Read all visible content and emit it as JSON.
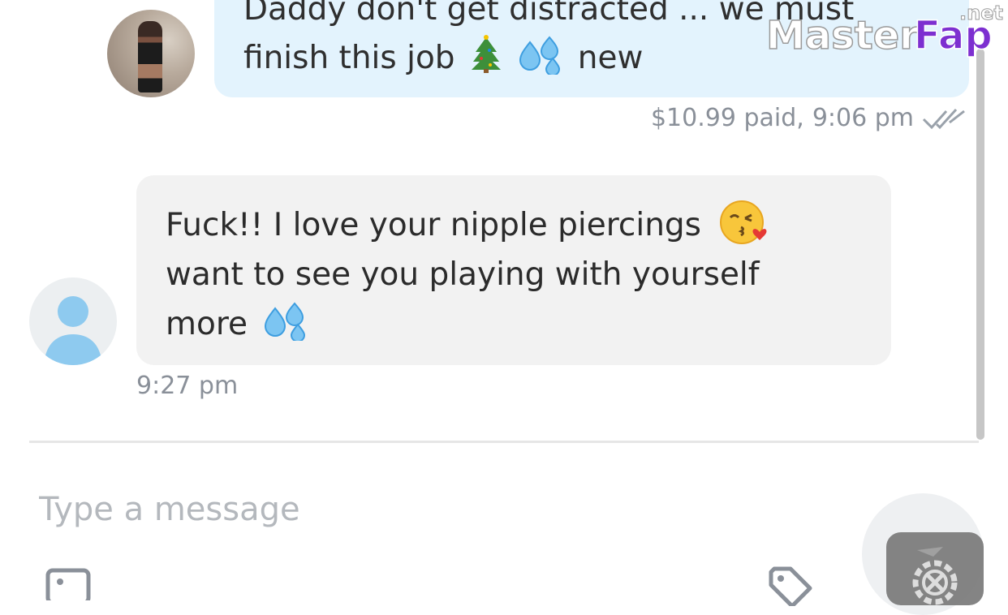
{
  "watermark": {
    "brand_part1": "Master",
    "brand_part2": "Fap",
    "suffix": ".net"
  },
  "conversation": {
    "sent_message": {
      "line1": "Daddy don't get distracted ... we must",
      "line2_start": "finish this job",
      "line2_end": "new",
      "emojis": [
        "christmas-tree",
        "sweat-droplets"
      ],
      "price": "$10.99 paid,",
      "time": "9:06 pm",
      "status_icon": "double-check-icon"
    },
    "received_message": {
      "line1": "Fuck!! I love your nipple piercings",
      "line2": "want to see you playing with yourself",
      "line3": "more",
      "emojis": [
        "face-blowing-a-kiss",
        "sweat-droplets"
      ],
      "time": "9:27 pm"
    }
  },
  "composer": {
    "placeholder": "Type a message",
    "icons": [
      "image-icon",
      "tag-icon",
      "send-icon"
    ]
  },
  "colors": {
    "sent_bubble": "#e3f3fd",
    "received_bubble": "#f2f2f2",
    "meta_text": "#8a9099",
    "placeholder": "#b4b8bd",
    "avatar_blue": "#8ecaef",
    "watermark_purple": "#7d2fd0"
  }
}
